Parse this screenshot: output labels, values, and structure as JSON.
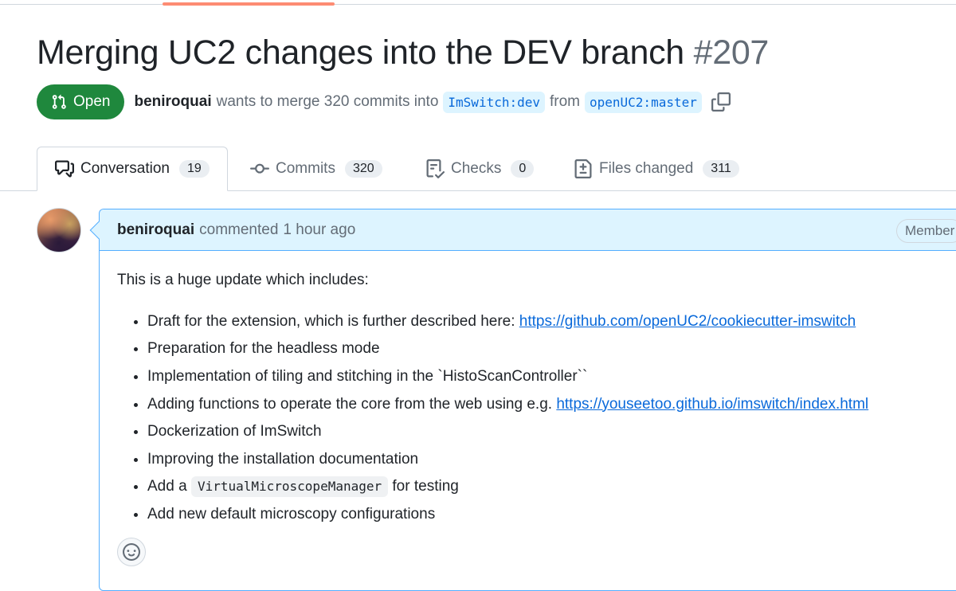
{
  "pr": {
    "title": "Merging UC2 changes into the DEV branch",
    "number": "#207",
    "state": "Open",
    "author": "beniroquai",
    "merge_text": "wants to merge 320 commits into",
    "base_branch": "ImSwitch:dev",
    "from_text": "from",
    "head_branch": "openUC2:master"
  },
  "tabs": [
    {
      "label": "Conversation",
      "count": "19",
      "icon": "comment-discussion-icon",
      "active": true
    },
    {
      "label": "Commits",
      "count": "320",
      "icon": "git-commit-icon",
      "active": false
    },
    {
      "label": "Checks",
      "count": "0",
      "icon": "checklist-icon",
      "active": false
    },
    {
      "label": "Files changed",
      "count": "311",
      "icon": "file-diff-icon",
      "active": false
    }
  ],
  "comment": {
    "author": "beniroquai",
    "action": "commented",
    "time": "1 hour ago",
    "role_badge": "Member",
    "intro": "This is a huge update which includes:",
    "items": {
      "i0_text": "Draft for the extension, which is further described here: ",
      "i0_link": "https://github.com/openUC2/cookiecutter-imswitch",
      "i1": "Preparation for the headless mode",
      "i2": "Implementation of tiling and stitching in the `HistoScanController``",
      "i3_text": "Adding functions to operate the core from the web using e.g. ",
      "i3_link": "https://youseetoo.github.io/imswitch/index.html",
      "i4": "Dockerization of ImSwitch",
      "i5": "Improving the installation documentation",
      "i6_pre": "Add a ",
      "i6_code": "VirtualMicroscopeManager",
      "i6_post": " for testing",
      "i7": "Add new default microscopy configurations"
    }
  },
  "colors": {
    "open_green": "#1f883d",
    "link_blue": "#0969da",
    "comment_header_bg": "#ddf4ff",
    "tab_accent": "#fd8c73"
  }
}
